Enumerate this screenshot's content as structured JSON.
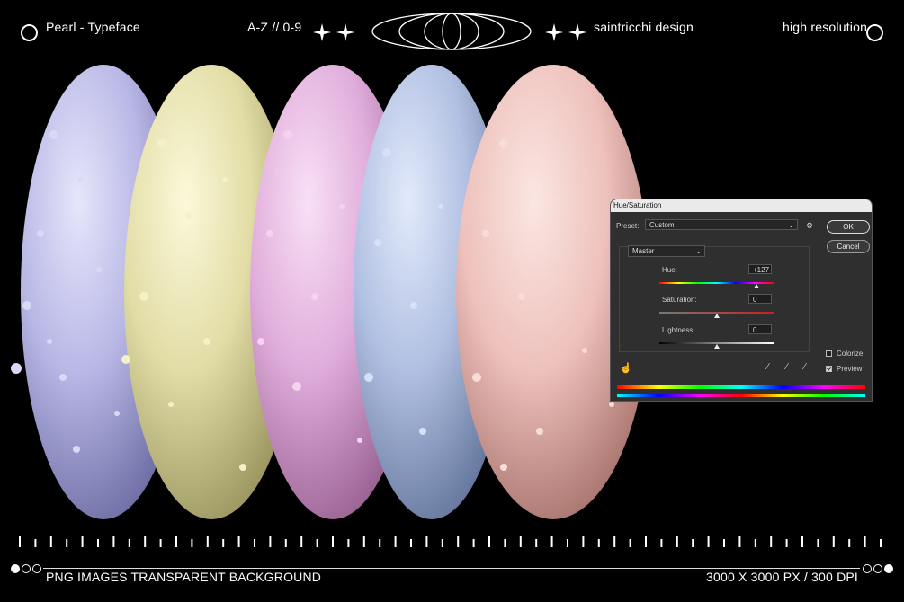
{
  "header": {
    "left_text": "Pearl -  Typeface",
    "center_text": "A-Z // 0-9",
    "brand_text": "saintricchi design",
    "right_text": "high resolution"
  },
  "footer": {
    "left_text": "PNG IMAGES TRANSPARENT BACKGROUND",
    "right_text": "3000 X 3000 PX / 300 DPI"
  },
  "colors": {
    "lavender": "#b9b8e6",
    "cream": "#e8e3b0",
    "pink": "#e3b4de",
    "blue": "#b4c3e4",
    "peach": "#efc3bf"
  },
  "dialog": {
    "title": "Hue/Saturation",
    "preset_label": "Preset:",
    "preset_value": "Custom",
    "ok_label": "OK",
    "cancel_label": "Cancel",
    "channel_value": "Master",
    "hue_label": "Hue:",
    "hue_value": "+127",
    "saturation_label": "Saturation:",
    "saturation_value": "0",
    "lightness_label": "Lightness:",
    "lightness_value": "0",
    "colorize_label": "Colorize",
    "colorize_checked": false,
    "preview_label": "Preview",
    "preview_checked": true,
    "hue_level": 127,
    "saturation_level": 0,
    "lightness_level": 0
  }
}
